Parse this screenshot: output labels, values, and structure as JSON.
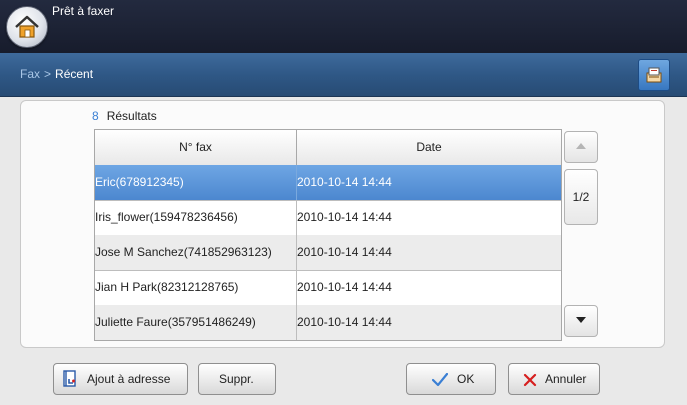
{
  "header": {
    "title": "Prêt à faxer"
  },
  "breadcrumb": {
    "parent": "Fax",
    "separator": ">",
    "current": "Récent"
  },
  "results": {
    "count": "8",
    "label": "Résultats"
  },
  "table": {
    "columns": [
      "N° fax",
      "Date"
    ],
    "rows": [
      {
        "fax": "Eric(678912345)",
        "date": "2010-10-14 14:44",
        "selected": true
      },
      {
        "fax": "Iris_flower(159478236456)",
        "date": "2010-10-14 14:44",
        "selected": false
      },
      {
        "fax": "Jose M Sanchez(741852963123)",
        "date": "2010-10-14 14:44",
        "selected": false
      },
      {
        "fax": "Jian H Park(82312128765)",
        "date": "2010-10-14 14:44",
        "selected": false
      },
      {
        "fax": "Juliette Faure(357951486249)",
        "date": "2010-10-14 14:44",
        "selected": false
      }
    ]
  },
  "pagination": {
    "label": "1/2"
  },
  "buttons": {
    "add_address": "Ajout à adresse",
    "delete": "Suppr.",
    "ok": "OK",
    "cancel": "Annuler"
  },
  "colors": {
    "accent": "#4c87cf",
    "ok_check": "#3a7fd4",
    "cancel_x": "#d62020"
  }
}
